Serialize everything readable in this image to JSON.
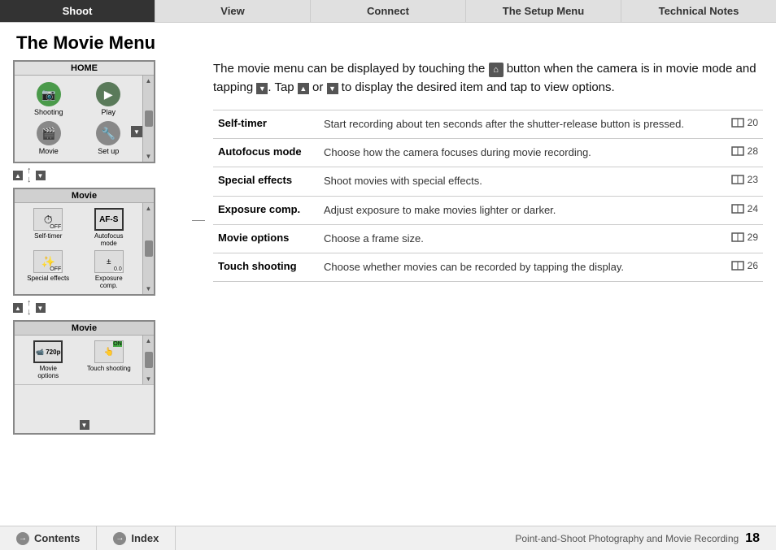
{
  "nav": {
    "tabs": [
      {
        "label": "Shoot",
        "active": true
      },
      {
        "label": "View",
        "active": false
      },
      {
        "label": "Connect",
        "active": false
      },
      {
        "label": "The Setup Menu",
        "active": false
      },
      {
        "label": "Technical Notes",
        "active": false
      }
    ]
  },
  "page": {
    "title": "The Movie Menu",
    "description_part1": "The movie menu can be displayed by touching the",
    "description_part2": "button when the camera is in movie mode and tapping",
    "description_part3": ". Tap",
    "description_part4": "or",
    "description_part5": "to display the desired item and tap to view options."
  },
  "home_screen": {
    "label": "HOME",
    "items": [
      {
        "name": "Shooting",
        "type": "shooting"
      },
      {
        "name": "Play",
        "type": "play"
      },
      {
        "name": "Movie",
        "type": "movie"
      },
      {
        "name": "Set up",
        "type": "setup"
      }
    ]
  },
  "movie_screen_1": {
    "label": "Movie",
    "items": [
      {
        "name": "Self-timer",
        "badge": "OFF",
        "icon": "timer"
      },
      {
        "name": "Autofocus mode",
        "badge": "AF-S",
        "icon": "af"
      },
      {
        "name": "Special effects",
        "badge": "OFF",
        "icon": "effects"
      },
      {
        "name": "Exposure comp.",
        "badge": "0.0",
        "icon": "exp"
      }
    ]
  },
  "movie_screen_2": {
    "label": "Movie",
    "items": [
      {
        "name": "Movie options",
        "badge": "720p",
        "icon": "movie-options"
      },
      {
        "name": "Touch shooting",
        "badge": "ON",
        "icon": "touch"
      }
    ]
  },
  "menu_items": [
    {
      "name": "Self-timer",
      "description": "Start recording about ten seconds after the shutter-release button is pressed.",
      "ref": "20"
    },
    {
      "name": "Autofocus mode",
      "description": "Choose how the camera focuses during movie recording.",
      "ref": "28"
    },
    {
      "name": "Special effects",
      "description": "Shoot movies with special effects.",
      "ref": "23"
    },
    {
      "name": "Exposure comp.",
      "description": "Adjust exposure to make movies lighter or darker.",
      "ref": "24"
    },
    {
      "name": "Movie options",
      "description": "Choose a frame size.",
      "ref": "29"
    },
    {
      "name": "Touch shooting",
      "description": "Choose whether movies can be recorded by tapping the display.",
      "ref": "26"
    }
  ],
  "bottom": {
    "contents_label": "Contents",
    "index_label": "Index",
    "footer_text": "Point-and-Shoot Photography and Movie Recording",
    "page_number": "18"
  }
}
